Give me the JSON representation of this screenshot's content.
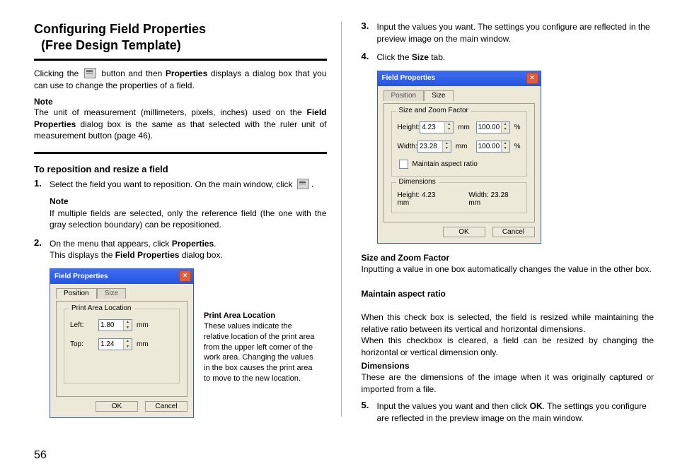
{
  "header": {
    "title_line1": "Configuring Field Properties",
    "title_line2": "(Free Design Template)"
  },
  "left": {
    "intro_a": "Clicking the ",
    "intro_b": " button and then ",
    "intro_bold": "Properties",
    "intro_c": " displays a dialog box that you can use to change the properties of a field.",
    "note_head": "Note",
    "note_body_a": "The unit of measurement (millimeters, pixels, inches) used on the ",
    "note_bold1": "Field Properties",
    "note_body_b": " dialog box is the same as that selected with the ruler unit of measurement button (page 46).",
    "sub_head": "To reposition and resize a field",
    "step1": "Select the field you want to reposition. On the main window, click ",
    "step1_note_head": "Note",
    "step1_note": "If multiple fields are selected, only the reference field (the one with the gray selection boundary) can be repositioned.",
    "step2_a": "On the menu that appears, click ",
    "step2_bold": "Properties",
    "step2_b": ".",
    "step2_line2_a": "This displays the ",
    "step2_line2_bold": "Field Properties",
    "step2_line2_b": " dialog box.",
    "dialog1": {
      "title": "Field Properties",
      "tab_position": "Position",
      "tab_size": "Size",
      "group": "Print Area Location",
      "left_label": "Left:",
      "left_value": "1.80",
      "top_label": "Top:",
      "top_value": "1.24",
      "unit": "mm",
      "ok": "OK",
      "cancel": "Cancel"
    },
    "caption1_head": "Print Area Location",
    "caption1_body": "These values indicate the relative location of the print area from the upper left corner of the work area. Changing the values in the box causes the print area to move to the new location."
  },
  "right": {
    "step3": "Input the values you want. The settings you configure are reflected in the preview image on the main window.",
    "step4_a": "Click the ",
    "step4_bold": "Size",
    "step4_b": " tab.",
    "dialog2": {
      "title": "Field Properties",
      "tab_position": "Position",
      "tab_size": "Size",
      "group1": "Size and Zoom Factor",
      "height_label": "Height:",
      "height_value": "4.23",
      "width_label": "Width:",
      "width_value": "23.28",
      "unit": "mm",
      "zoom_value": "100.00",
      "pct": "%",
      "maintain": "Maintain aspect ratio",
      "group2": "Dimensions",
      "dim_h": "Height:   4.23  mm",
      "dim_w": "Width:   23.28  mm",
      "ok": "OK",
      "cancel": "Cancel"
    },
    "sz_head": "Size and Zoom Factor",
    "sz_body": "Inputting a value in one box automatically changes the value in the other box.",
    "mar_head": "Maintain aspect ratio",
    "mar_body": "When this check box is selected, the field is resized while maintaining the relative ratio between its vertical and horizontal dimensions.\nWhen this checkbox is cleared, a field can be resized by changing the horizontal or vertical dimension only.",
    "dim_head": "Dimensions",
    "dim_body": "These are the dimensions of the image when it was originally captured or imported from a file.",
    "step5_a": "Input the values you want and then click ",
    "step5_bold": "OK",
    "step5_b": ". The settings you configure are reflected in the preview image on the main window."
  },
  "pagenum": "56"
}
